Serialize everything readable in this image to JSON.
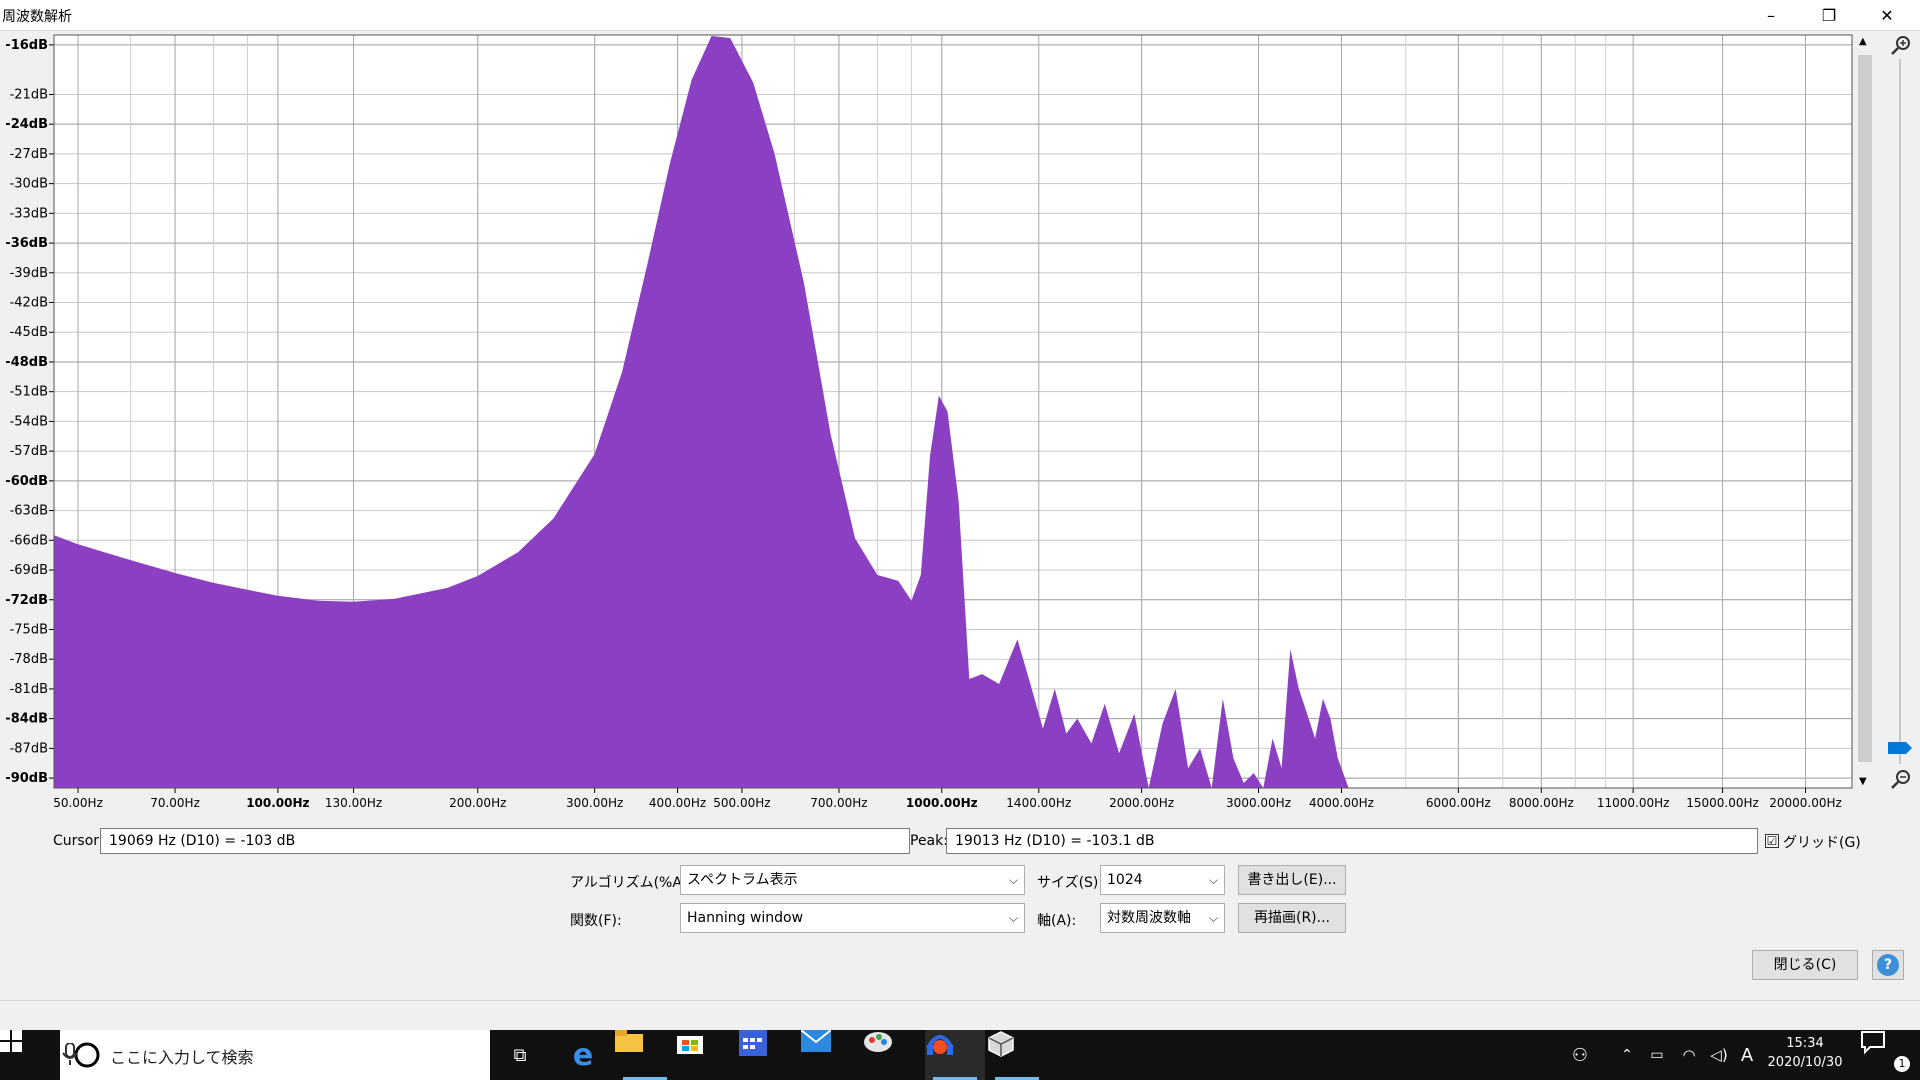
{
  "window": {
    "title": "周波数解析",
    "minimize": "–",
    "restore": "❐",
    "close": "✕"
  },
  "chart_data": {
    "type": "area",
    "title": "",
    "xscale": "log",
    "xlim": [
      46,
      23500
    ],
    "ylim": [
      -91,
      -15
    ],
    "fill_color": "#8b3fc3",
    "grid": true,
    "y_ticks": [
      "-16dB",
      "-21dB",
      "-24dB",
      "-27dB",
      "-30dB",
      "-33dB",
      "-36dB",
      "-39dB",
      "-42dB",
      "-45dB",
      "-48dB",
      "-51dB",
      "-54dB",
      "-57dB",
      "-60dB",
      "-63dB",
      "-66dB",
      "-69dB",
      "-72dB",
      "-75dB",
      "-78dB",
      "-81dB",
      "-84dB",
      "-87dB",
      "-90dB"
    ],
    "y_tick_values": [
      -16,
      -21,
      -24,
      -27,
      -30,
      -33,
      -36,
      -39,
      -42,
      -45,
      -48,
      -51,
      -54,
      -57,
      -60,
      -63,
      -66,
      -69,
      -72,
      -75,
      -78,
      -81,
      -84,
      -87,
      -90
    ],
    "y_bold": [
      "-16dB",
      "-24dB",
      "-36dB",
      "-48dB",
      "-60dB",
      "-72dB",
      "-84dB",
      "-90dB"
    ],
    "x_ticks": [
      "50.00Hz",
      "70.00Hz",
      "100.00Hz",
      "130.00Hz",
      "200.00Hz",
      "300.00Hz",
      "400.00Hz",
      "500.00Hz",
      "700.00Hz",
      "1000.00Hz",
      "1400.00Hz",
      "2000.00Hz",
      "3000.00Hz",
      "4000.00Hz",
      "6000.00Hz",
      "8000.00Hz",
      "11000.00Hz",
      "15000.00Hz",
      "20000.00Hz"
    ],
    "x_tick_values": [
      50,
      70,
      100,
      130,
      200,
      300,
      400,
      500,
      700,
      1000,
      1400,
      2000,
      3000,
      4000,
      6000,
      8000,
      11000,
      15000,
      20000
    ],
    "x_bold": [
      "100.00Hz",
      "1000.00Hz"
    ],
    "x": [
      46,
      50,
      60,
      70,
      80,
      90,
      100,
      115,
      130,
      150,
      180,
      200,
      230,
      260,
      300,
      330,
      360,
      390,
      420,
      450,
      480,
      520,
      560,
      620,
      680,
      740,
      800,
      860,
      900,
      930,
      960,
      990,
      1020,
      1060,
      1100,
      1150,
      1220,
      1300,
      1360,
      1420,
      1480,
      1540,
      1600,
      1680,
      1760,
      1850,
      1950,
      2050,
      2150,
      2250,
      2350,
      2450,
      2550,
      2650,
      2750,
      2850,
      2950,
      3050,
      3150,
      3250,
      3350,
      3450,
      3550,
      3650,
      3750,
      3850,
      3950,
      4100
    ],
    "y": [
      -65.5,
      -66.4,
      -68.0,
      -69.3,
      -70.3,
      -71.0,
      -71.6,
      -72.1,
      -72.2,
      -71.9,
      -70.8,
      -69.6,
      -67.2,
      -63.8,
      -57.3,
      -49.0,
      -38.2,
      -27.8,
      -19.5,
      -15.1,
      -15.3,
      -19.8,
      -27.0,
      -40.0,
      -55.3,
      -65.8,
      -69.5,
      -70.1,
      -72.1,
      -69.5,
      -57.5,
      -51.4,
      -53.0,
      -62.0,
      -80.0,
      -79.5,
      -80.5,
      -76.0,
      -80.5,
      -85.0,
      -81.0,
      -85.5,
      -84.0,
      -86.5,
      -82.5,
      -87.5,
      -83.5,
      -91.0,
      -84.5,
      -81.0,
      -89.0,
      -87.0,
      -91.0,
      -82.0,
      -88.0,
      -90.5,
      -89.5,
      -91.0,
      -86.0,
      -89.0,
      -77.0,
      -81.0,
      -83.5,
      -86.0,
      -82.0,
      -84.0,
      -88.0,
      -91.0
    ]
  },
  "cursor": {
    "label": "Cursor:",
    "value": "19069 Hz (D10) = -103 dB"
  },
  "peak": {
    "label": "Peak:",
    "value": "19013 Hz (D10) = -103.1 dB"
  },
  "grid_check": {
    "label": "グリッド(G)",
    "checked": "☑"
  },
  "algorithm": {
    "label": "アルゴリズム(%A):",
    "value": "スペクトラム表示"
  },
  "func": {
    "label": "関数(F):",
    "value": "Hanning window"
  },
  "size": {
    "label": "サイズ(S):",
    "value": "1024"
  },
  "axis": {
    "label": "軸(A):",
    "value": "対数周波数軸"
  },
  "export_button": "書き出し(E)...",
  "redraw_button": "再描画(R)...",
  "close_button": "閉じる(C)",
  "help_button": "?",
  "taskbar": {
    "search_placeholder": "ここに入力して検索",
    "time": "15:34",
    "date": "2020/10/30",
    "ime": "A",
    "notification_count": "1"
  }
}
